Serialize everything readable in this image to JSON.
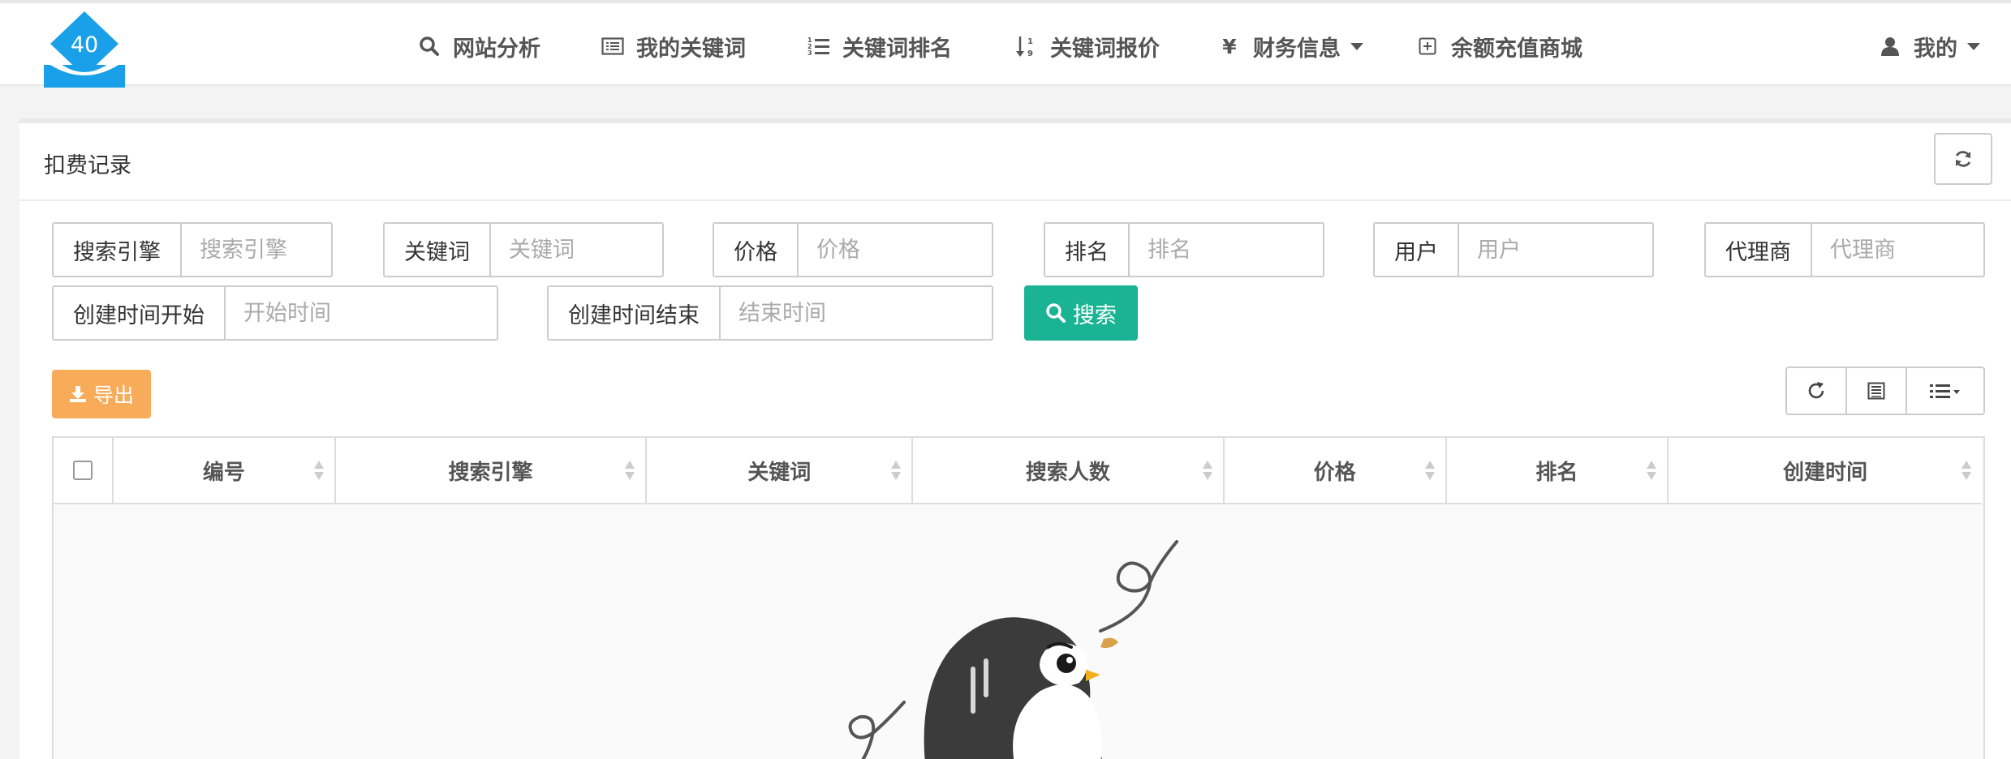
{
  "logo": {
    "badge_text": "40"
  },
  "nav": {
    "items": [
      {
        "label": "网站分析",
        "icon": "search-icon"
      },
      {
        "label": "我的关键词",
        "icon": "list-alt-icon"
      },
      {
        "label": "关键词排名",
        "icon": "list-ol-icon"
      },
      {
        "label": "关键词报价",
        "icon": "sort-numeric-icon"
      },
      {
        "label": "财务信息",
        "icon": "yen-icon",
        "dropdown": true
      },
      {
        "label": "余额充值商城",
        "icon": "plus-square-icon"
      }
    ],
    "user_menu": {
      "label": "我的",
      "icon": "user-icon",
      "dropdown": true
    }
  },
  "panel": {
    "title": "扣费记录",
    "refresh_icon": "refresh-icon"
  },
  "filters": {
    "search_engine": {
      "label": "搜索引擎",
      "placeholder": "搜索引擎"
    },
    "keyword": {
      "label": "关键词",
      "placeholder": "关键词"
    },
    "price": {
      "label": "价格",
      "placeholder": "价格"
    },
    "rank": {
      "label": "排名",
      "placeholder": "排名"
    },
    "user": {
      "label": "用户",
      "placeholder": "用户"
    },
    "agent": {
      "label": "代理商",
      "placeholder": "代理商"
    },
    "created_start": {
      "label": "创建时间开始",
      "placeholder": "开始时间"
    },
    "created_end": {
      "label": "创建时间结束",
      "placeholder": "结束时间"
    },
    "search_button": "搜索"
  },
  "toolbar": {
    "export_label": "导出",
    "icons": [
      "refresh-icon",
      "table-icon",
      "columns-list-icon"
    ]
  },
  "table": {
    "columns": [
      "编号",
      "搜索引擎",
      "关键词",
      "搜索人数",
      "价格",
      "排名",
      "创建时间"
    ],
    "rows": []
  },
  "colors": {
    "primary": "#1ab394",
    "warning": "#f8ac59",
    "logo_blue": "#1aa0e8"
  }
}
